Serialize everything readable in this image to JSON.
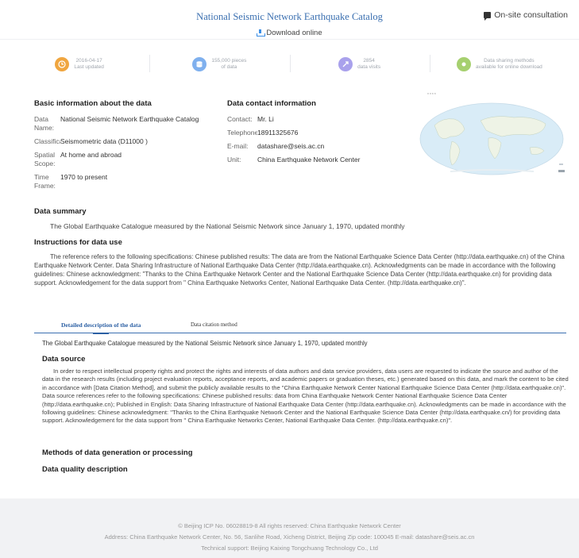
{
  "header": {
    "title": "National Seismic Network Earthquake Catalog",
    "consultation": "On-site consultation",
    "download": "Download online"
  },
  "stats": [
    {
      "line1": "2016-04-17",
      "line2": "Last updated",
      "icon": "clock-icon",
      "color": "#f0a640"
    },
    {
      "line1": "155,000 pieces",
      "line2": "of data",
      "icon": "database-icon",
      "color": "#7fb0ee"
    },
    {
      "line1": "2854",
      "line2": "data visits",
      "icon": "visits-icon",
      "color": "#a9a1ec"
    },
    {
      "line1": "Data sharing methods",
      "line2": "available for online download",
      "icon": "share-icon",
      "color": "#a6d06f"
    }
  ],
  "basic": {
    "heading": "Basic information about the data",
    "items": [
      {
        "key": "Data Name:",
        "value": "National Seismic Network Earthquake Catalog"
      },
      {
        "key": "Classification",
        "value": "Seismometric data (D11000 )"
      },
      {
        "key": "Spatial Scope:",
        "value": "At home and abroad"
      },
      {
        "key": "Time Frame:",
        "value": "1970 to present"
      }
    ]
  },
  "contact": {
    "heading": "Data contact information",
    "items": [
      {
        "key": "Contact:",
        "value": "Mr. Li"
      },
      {
        "key": "Telephone",
        "value": "18911325676"
      },
      {
        "key": "E-mail:",
        "value": "datashare@seis.ac.cn"
      },
      {
        "key": "Unit:",
        "value": "China Earthquake Network Center"
      }
    ]
  },
  "map": {
    "label": "****"
  },
  "summary": {
    "heading": "Data summary",
    "text": "The Global Earthquake Catalogue measured by the National Seismic Network since January 1, 1970, updated monthly"
  },
  "instructions": {
    "heading": "Instructions for data use",
    "text": "The reference refers to the following specifications: Chinese published results: The data are from the National Earthquake Science Data Center (http://data.earthquake.cn) of the China Earthquake Network Center. Data Sharing Infrastructure of National Earthquake Data Center (http://data.earthquake.cn). Acknowledgments can be made in accordance with the following guidelines: Chinese acknowledgment: \"Thanks to the China Earthquake Network Center and the National Earthquake Science Data Center (http://data.earthquake.cn) for providing data support. Acknowledgement for the data support from \" China Earthquake Networks Center, National Earthquake Data Center. (http://data.earthquake.cn)\"."
  },
  "tabs": {
    "active": "Detailed description of the data",
    "other": "Data citation method"
  },
  "description": {
    "line": "The Global Earthquake Catalogue measured by the National Seismic Network since January 1, 1970, updated monthly",
    "source_heading": "Data source",
    "source_text": "In order to respect intellectual property rights and protect the rights and interests of data authors and data service providers, data users are requested to indicate the source and author of the data in the research results (including project evaluation reports, acceptance reports, and academic papers or graduation theses, etc.) generated based on this data, and mark the content to be cited in accordance with [Data Citation Method], and submit the publicly available results to the \"China Earthquake Network Center National Earthquake Science Data Center (http://data.earthquake.cn)\". Data source references refer to the following specifications: Chinese published results: data from China Earthquake Network Center National Earthquake Science Data Center (http://data.earthquake.cn); Published in English: Data Sharing Infrastructure of National Earthquake Data Center (http://data.earthquake.cn). Acknowledgments can be made in accordance with the following guidelines: Chinese acknowledgment: \"Thanks to the China Earthquake Network Center and the National Earthquake Science Data Center (http://data.earthquake.cn/) for providing data support. Acknowledgement for the data support from \" China Earthquake Networks Center, National Earthquake Data Center. (http://data.earthquake.cn)\".",
    "methods_heading": "Methods of data generation or processing",
    "quality_heading": "Data quality description"
  },
  "footer": {
    "line1": "© Beijing ICP No. 06028819-8 All rights reserved: China Earthquake Network Center",
    "line2": "Address: China Earthquake Network Center, No. 56, Sanlihe Road, Xicheng District, Beijing Zip code: 100045 E-mail: datashare@seis.ac.cn",
    "line3": "Technical support: Beijing Kaixing Tongchuang Technology Co., Ltd"
  }
}
